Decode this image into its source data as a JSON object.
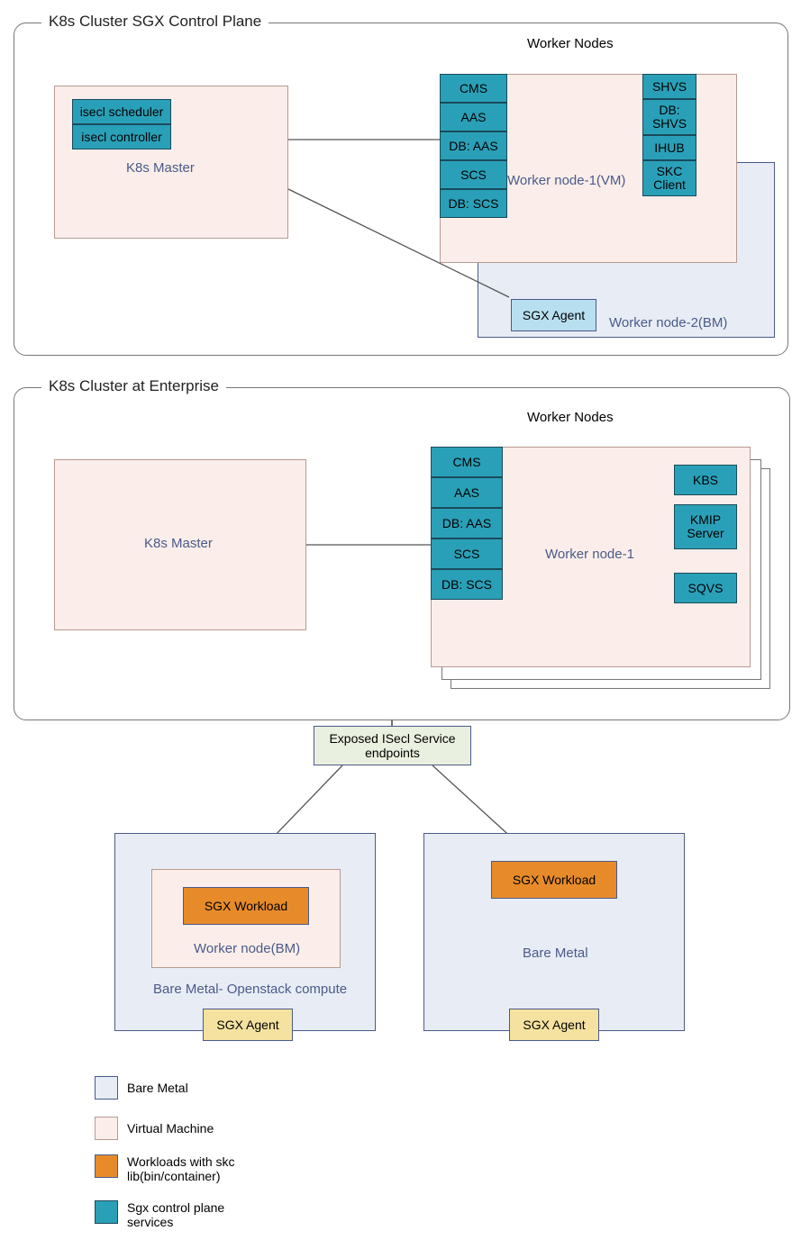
{
  "diagram": {
    "group1_title": "K8s Cluster SGX Control Plane",
    "group1_workers_label": "Worker Nodes",
    "group1_master_label": "K8s Master",
    "group1_master_services": {
      "scheduler": "isecl scheduler",
      "controller": "isecl controller"
    },
    "group1_worker1_label": "Worker node-1(VM)",
    "group1_worker1_left": [
      "CMS",
      "AAS",
      "DB: AAS",
      "SCS",
      "DB: SCS"
    ],
    "group1_worker1_right": [
      "SHVS",
      "DB: SHVS",
      "IHUB",
      "SKC Client"
    ],
    "group1_worker2_label": "Worker node-2(BM)",
    "group1_sgx_agent": "SGX Agent",
    "group2_title": "K8s Cluster at Enterprise",
    "group2_workers_label": "Worker Nodes",
    "group2_master_label": "K8s Master",
    "group2_worker1_label": "Worker node-1",
    "group2_worker1_left": [
      "CMS",
      "AAS",
      "DB: AAS",
      "SCS",
      "DB: SCS"
    ],
    "group2_worker1_right": [
      "KBS",
      "KMIP Server",
      "SQVS"
    ],
    "endpoints_label": "Exposed ISecl Service endpoints",
    "bm_left_title": "Bare Metal- Openstack compute",
    "bm_left_vm_label": "Worker node(BM)",
    "bm_right_title": "Bare Metal",
    "sgx_workload": "SGX Workload",
    "sgx_agent": "SGX Agent",
    "legend": {
      "bare_metal": "Bare Metal",
      "vm": "Virtual Machine",
      "workloads": "Workloads with skc lib(bin/container)",
      "sgx_services": "Sgx control plane services"
    }
  }
}
